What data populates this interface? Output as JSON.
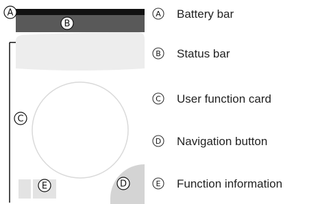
{
  "markers": {
    "a": "A",
    "b": "B",
    "c": "C",
    "d": "D",
    "e": "E"
  },
  "legend": [
    {
      "marker": "A",
      "label": "Battery bar"
    },
    {
      "marker": "B",
      "label": "Status bar"
    },
    {
      "marker": "C",
      "label": "User function card"
    },
    {
      "marker": "D",
      "label": "Navigation button"
    },
    {
      "marker": "E",
      "label": "Function information"
    }
  ],
  "colors": {
    "battery_bar": "#111111",
    "status_bar": "#595959",
    "card": "#ededed",
    "circle": "#d9d9d9",
    "nav_button": "#d4d4d4",
    "info_blocks": "#e3e3e3",
    "text": "#222222"
  }
}
